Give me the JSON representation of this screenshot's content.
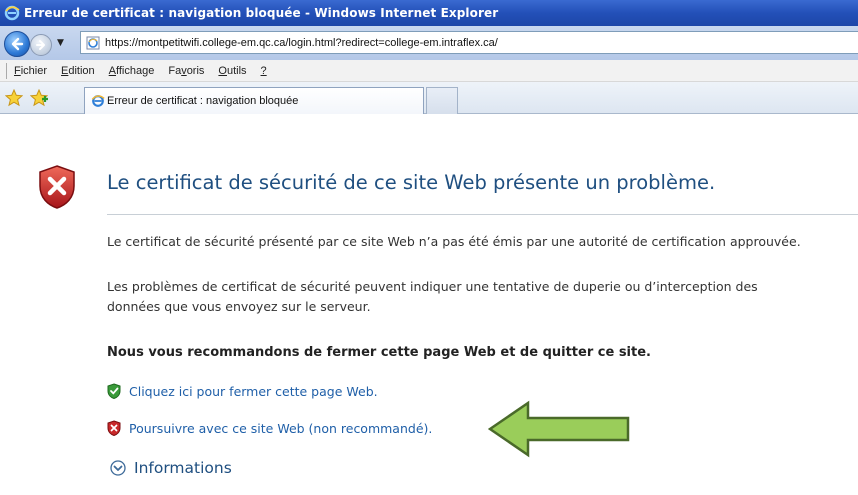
{
  "window": {
    "title": "Erreur de certificat : navigation bloquée - Windows Internet Explorer"
  },
  "address_bar": {
    "url": "https://montpetitwifi.college-em.qc.ca/login.html?redirect=college-em.intraflex.ca/"
  },
  "menu": {
    "items": [
      {
        "pre": "",
        "ul": "F",
        "post": "ichier"
      },
      {
        "pre": "",
        "ul": "E",
        "post": "dition"
      },
      {
        "pre": "",
        "ul": "A",
        "post": "ffichage"
      },
      {
        "pre": "Fa",
        "ul": "v",
        "post": "oris"
      },
      {
        "pre": "",
        "ul": "O",
        "post": "utils"
      },
      {
        "pre": "",
        "ul": "?",
        "post": ""
      }
    ]
  },
  "tab": {
    "label": "Erreur de certificat : navigation bloquée"
  },
  "page": {
    "heading": "Le certificat de sécurité de ce site Web présente un problème.",
    "paragraph1": "Le certificat de sécurité présenté par ce site Web n’a pas été émis par une autorité de certification approuvée.",
    "paragraph2_line1": "Les problèmes de certificat de sécurité peuvent indiquer une tentative de duperie ou d’interception des",
    "paragraph2_line2": "données que vous envoyez sur le serveur.",
    "recommendation": "Nous vous recommandons de fermer cette page Web et de quitter ce site.",
    "close_link": "Cliquez ici pour fermer cette page Web.",
    "continue_link": "Poursuivre avec ce site Web (non recommandé).",
    "more_info": "Informations"
  },
  "colors": {
    "titlebar": "#2350b8",
    "heading": "#1f4f80",
    "link": "#1f5fa8",
    "arrow": "#9acd5a"
  }
}
